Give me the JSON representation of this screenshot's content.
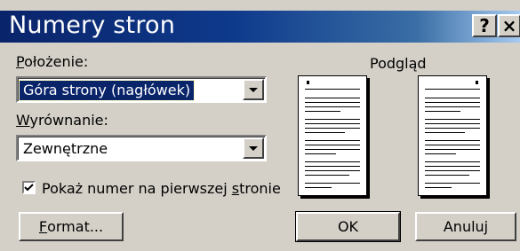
{
  "window": {
    "title": "Numery stron",
    "help_label": "?",
    "close_label": "×"
  },
  "position": {
    "label_u": "P",
    "label_rest": "ołożenie:",
    "value": "Góra strony (nagłówek)"
  },
  "alignment": {
    "label_u": "W",
    "label_rest": "yrównanie:",
    "value": "Zewnętrzne"
  },
  "first_page_checkbox": {
    "checked": true,
    "label_pre": "Pokaż numer na pierwszej ",
    "label_u": "s",
    "label_post": "tronie"
  },
  "preview": {
    "label": "Podgląd"
  },
  "buttons": {
    "format_u": "F",
    "format_rest": "ormat...",
    "ok": "OK",
    "cancel": "Anuluj"
  }
}
